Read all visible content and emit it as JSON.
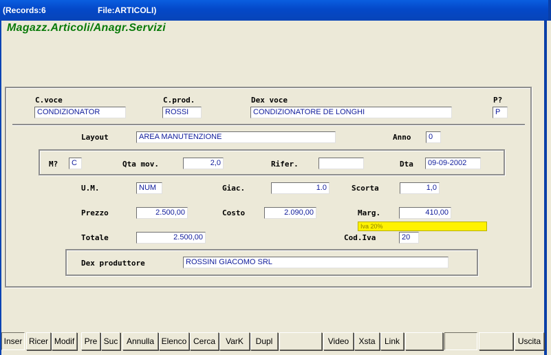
{
  "titlebar": {
    "records": "(Records:6",
    "file": "File:ARTICOLI)"
  },
  "app_title": "Magazz.Articoli/Anagr.Servizi",
  "header": {
    "c_voce": {
      "label": "C.voce",
      "value": "CONDIZIONATOR"
    },
    "c_prod": {
      "label": "C.prod.",
      "value": "ROSSI"
    },
    "dex_voce": {
      "label": "Dex voce",
      "value": "CONDIZIONATORE DE LONGHI"
    },
    "p": {
      "label": "P?",
      "value": "P"
    }
  },
  "layout": {
    "label": "Layout",
    "value": "AREA MANUTENZIONE"
  },
  "anno": {
    "label": "Anno",
    "value": "0"
  },
  "movimento": {
    "m": {
      "label": "M?",
      "value": "C"
    },
    "qta_mov": {
      "label": "Qta mov.",
      "value": "2,0"
    },
    "rifer": {
      "label": "Rifer.",
      "value": ""
    },
    "dta": {
      "label": "Dta",
      "value": "09-09-2002"
    }
  },
  "um": {
    "label": "U.M.",
    "value": "NUM"
  },
  "giac": {
    "label": "Giac.",
    "value": "1.0"
  },
  "scorta": {
    "label": "Scorta",
    "value": "1,0"
  },
  "prezzo": {
    "label": "Prezzo",
    "value": "2.500,00"
  },
  "costo": {
    "label": "Costo",
    "value": "2.090,00"
  },
  "marg": {
    "label": "Marg.",
    "value": "410,00"
  },
  "iva_info": "Iva 20%",
  "totale": {
    "label": "Totale",
    "value": "2.500,00"
  },
  "cod_iva": {
    "label": "Cod.Iva",
    "value": "20"
  },
  "produttore": {
    "label": "Dex produttore",
    "value": "ROSSINI GIACOMO SRL"
  },
  "toolbar": {
    "inser": "Inser",
    "ricer": "Ricer",
    "modif": "Modif",
    "pre": "Pre",
    "suc": "Suc",
    "annulla": "Annulla",
    "elenco": "Elenco",
    "cerca": "Cerca",
    "vark": "VarK",
    "dupl": "Dupl",
    "video": "Video",
    "xsta": "Xsta",
    "link": "Link",
    "uscita": "Uscita"
  },
  "colors": {
    "titlebar": "#0A5EE0",
    "app_title": "#0A7A0A",
    "field_text": "#0E1A9A",
    "iva_bar": "#FFF200",
    "background": "#ECE9D8"
  }
}
